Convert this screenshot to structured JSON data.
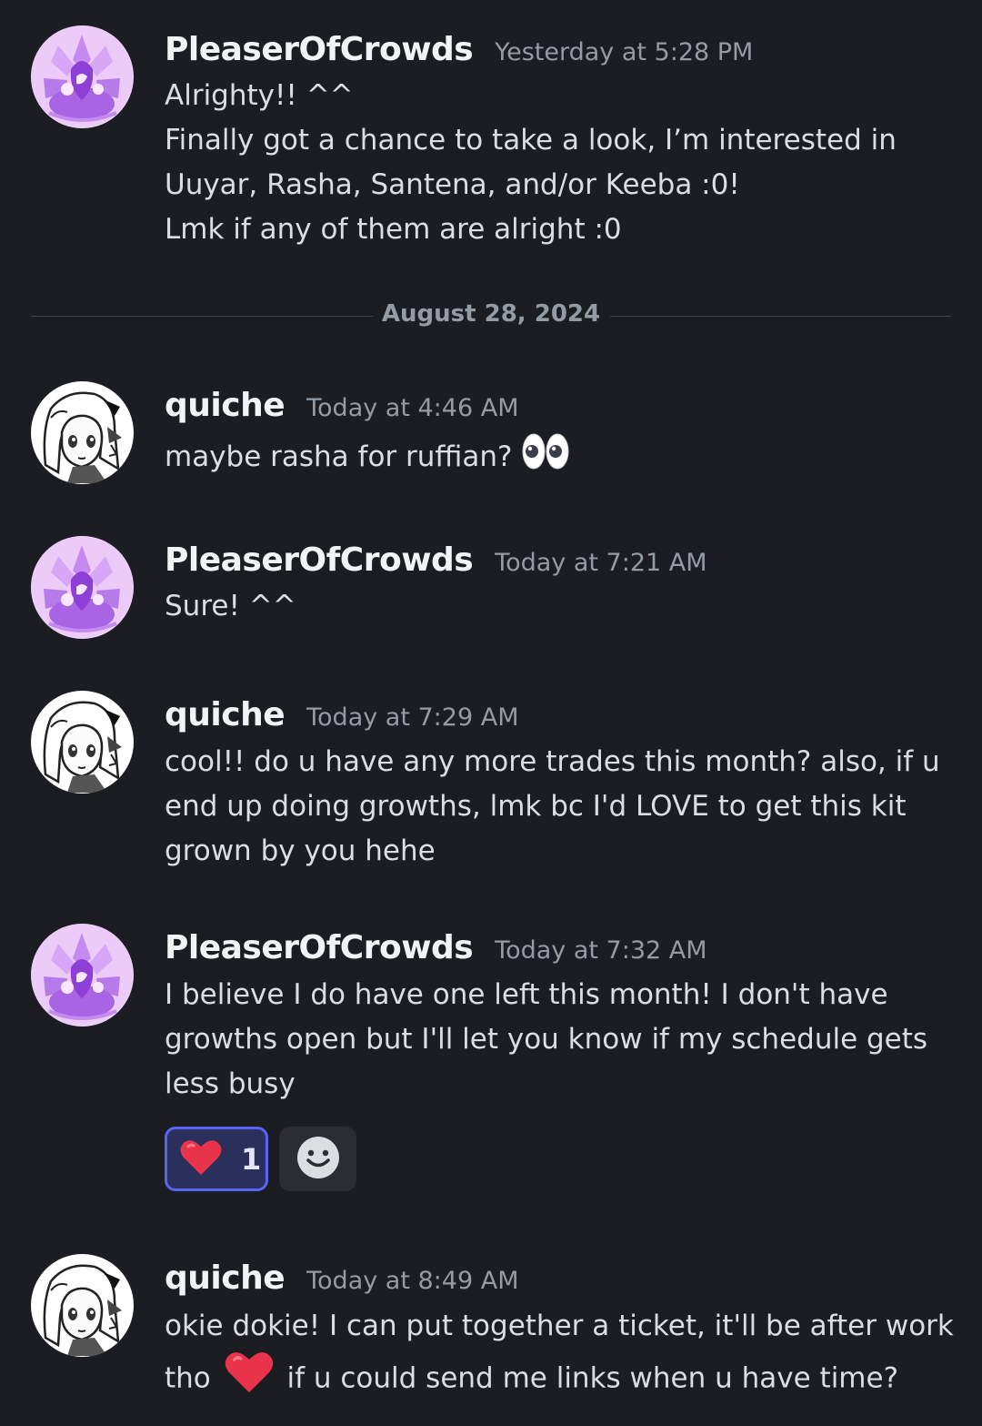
{
  "date_divider": "August 28, 2024",
  "messages": [
    {
      "author": "PleaserOfCrowds",
      "timestamp": "Yesterday at 5:28 PM",
      "lines": [
        "Alrighty!! ^^",
        "Finally got a chance to take a look, I’m interested in",
        "Uuyar, Rasha, Santena, and/or Keeba :0!",
        "Lmk if any of them are alright :0"
      ]
    },
    {
      "author": "quiche",
      "timestamp": "Today at 4:46 AM",
      "lines": [
        "maybe rasha for ruffian?"
      ],
      "trailing_emoji": "eyes-emoji"
    },
    {
      "author": "PleaserOfCrowds",
      "timestamp": "Today at 7:21 AM",
      "lines": [
        "Sure! ^^"
      ]
    },
    {
      "author": "quiche",
      "timestamp": "Today at 7:29 AM",
      "lines": [
        "cool!! do u have any more trades this month? also, if u",
        "end up doing growths, lmk bc I'd LOVE to get this kit",
        "grown by you hehe"
      ]
    },
    {
      "author": "PleaserOfCrowds",
      "timestamp": "Today at 7:32 AM",
      "lines": [
        "I believe I do have one left this month! I don't have",
        "growths open but I'll let you know if my schedule gets",
        "less busy"
      ],
      "reactions": [
        {
          "emoji": "heart-emoji",
          "count": "1",
          "active": true
        },
        {
          "emoji": "add-reaction-icon",
          "count": ""
        }
      ]
    },
    {
      "author": "quiche",
      "timestamp": "Today at 8:49 AM",
      "lines": [
        "okie dokie! I can put together a ticket, it'll be after work",
        "tho",
        "if u could send me links when u have time?"
      ],
      "inline_emoji": "heart-emoji"
    }
  ],
  "colors": {
    "background": "#1c1d23",
    "username": "#f2f3f5",
    "timestamp": "#949ba4",
    "text": "#dbdee1",
    "reaction_active_bg": "#2b2f5c",
    "reaction_active_border": "#5865f2",
    "heart": "#e8334a"
  }
}
